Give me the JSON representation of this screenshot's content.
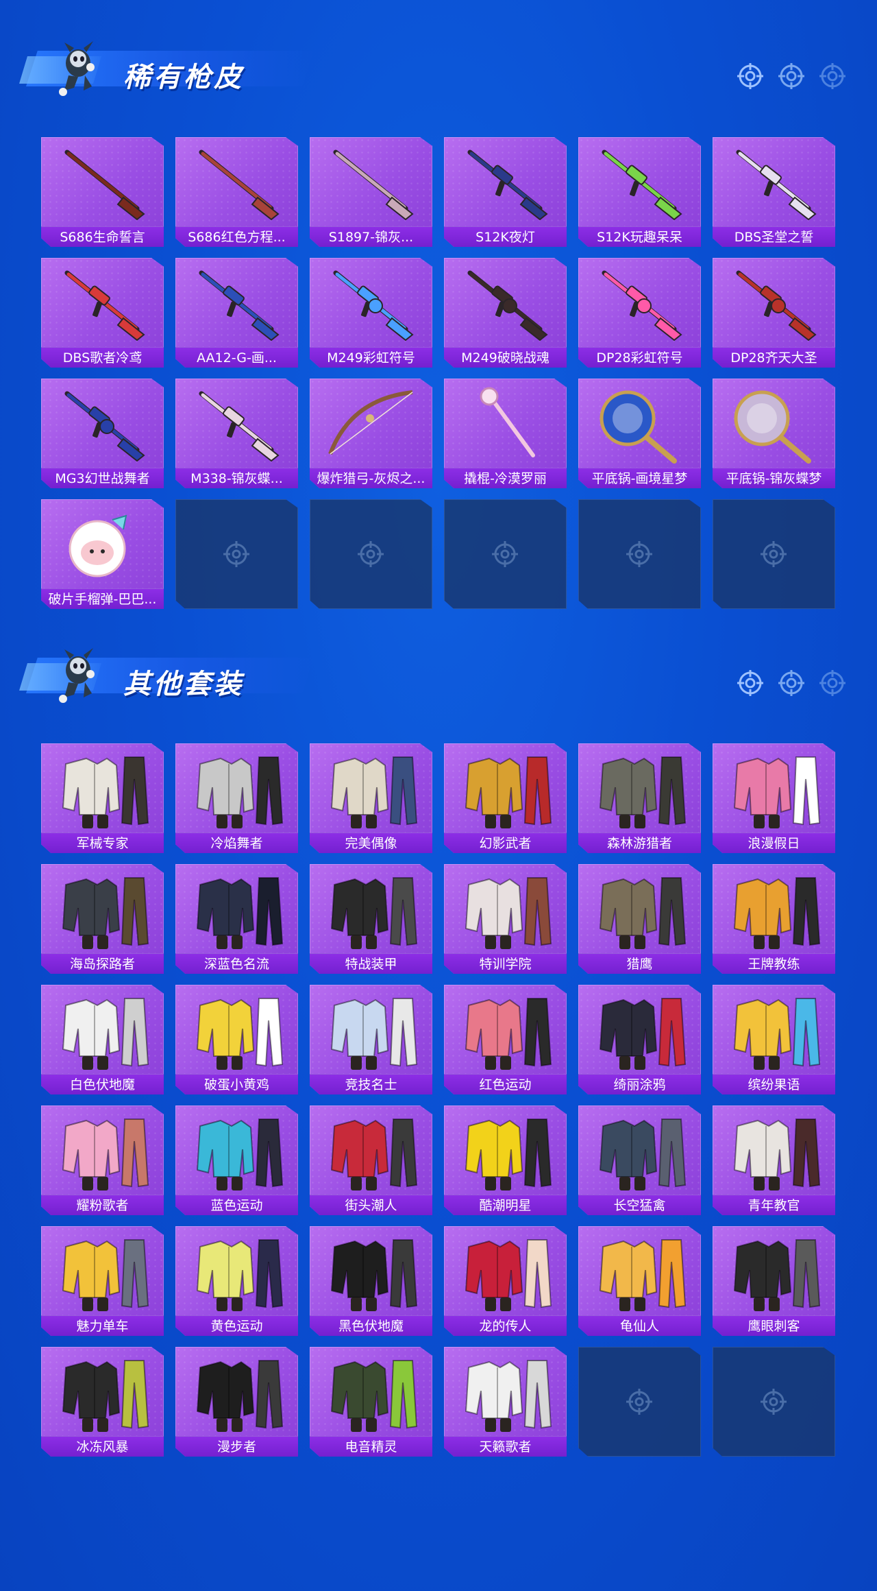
{
  "sections": [
    {
      "title": "稀有枪皮",
      "items": [
        {
          "label": "S686生命誓言",
          "kind": "shotgun",
          "color": "#7a2a1e"
        },
        {
          "label": "S686红色方程...",
          "kind": "shotgun",
          "color": "#a8433a"
        },
        {
          "label": "S1897-锦灰...",
          "kind": "shotgun",
          "color": "#c9a9b8"
        },
        {
          "label": "S12K夜灯",
          "kind": "rifle",
          "color": "#2a3a8a"
        },
        {
          "label": "S12K玩趣呆呆",
          "kind": "rifle",
          "color": "#7ad44a"
        },
        {
          "label": "DBS圣堂之誓",
          "kind": "rifle",
          "color": "#e6e0ef"
        },
        {
          "label": "DBS歌者冷鸢",
          "kind": "rifle",
          "color": "#d83a3a"
        },
        {
          "label": "AA12-G-画...",
          "kind": "rifle",
          "color": "#2c4fb8"
        },
        {
          "label": "M249彩虹符号",
          "kind": "lmg",
          "color": "#4aa0ff"
        },
        {
          "label": "M249破晓战魂",
          "kind": "lmg",
          "color": "#3a2a2a"
        },
        {
          "label": "DP28彩虹符号",
          "kind": "lmg",
          "color": "#ff5aa8"
        },
        {
          "label": "DP28齐天大圣",
          "kind": "lmg",
          "color": "#b8322a"
        },
        {
          "label": "MG3幻世战舞者",
          "kind": "lmg",
          "color": "#2840a8"
        },
        {
          "label": "M338-锦灰蝶...",
          "kind": "rifle",
          "color": "#e8d6e0"
        },
        {
          "label": "爆炸猎弓-灰烬之...",
          "kind": "bow",
          "color": "#8a5a3a"
        },
        {
          "label": "撬棍-冷漠罗丽",
          "kind": "staff",
          "color": "#f2c8e0"
        },
        {
          "label": "平底锅-画境星梦",
          "kind": "pan",
          "color": "#2a58c8"
        },
        {
          "label": "平底锅-锦灰蝶梦",
          "kind": "pan",
          "color": "#c8b8d8"
        },
        {
          "label": "破片手榴弹-巴巴...",
          "kind": "grenade",
          "color": "#ffffff"
        }
      ],
      "empty_slots": 5
    },
    {
      "title": "其他套装",
      "items": [
        {
          "label": "军械专家",
          "color": "#e8e4dc",
          "accent": "#3a3530"
        },
        {
          "label": "冷焰舞者",
          "color": "#c8c8c8",
          "accent": "#2a2a2a"
        },
        {
          "label": "完美偶像",
          "color": "#e0d8c8",
          "accent": "#3a4f80"
        },
        {
          "label": "幻影武者",
          "color": "#d8a030",
          "accent": "#b82a2a"
        },
        {
          "label": "森林游猎者",
          "color": "#6a6a60",
          "accent": "#3a3a34"
        },
        {
          "label": "浪漫假日",
          "color": "#e87aa8",
          "accent": "#ffffff"
        },
        {
          "label": "海岛探路者",
          "color": "#3a3f48",
          "accent": "#5a4a30"
        },
        {
          "label": "深蓝色名流",
          "color": "#2a3048",
          "accent": "#1a1e2e"
        },
        {
          "label": "特战装甲",
          "color": "#2a2a2a",
          "accent": "#4a4a4a"
        },
        {
          "label": "特训学院",
          "color": "#e8e0e0",
          "accent": "#8a4a3a"
        },
        {
          "label": "猎鹰",
          "color": "#7a6e58",
          "accent": "#3a3a38"
        },
        {
          "label": "王牌教练",
          "color": "#e8a030",
          "accent": "#2a2a2a"
        },
        {
          "label": "白色伏地魔",
          "color": "#f0f0f0",
          "accent": "#cfcfcf"
        },
        {
          "label": "破蛋小黄鸡",
          "color": "#f2d23a",
          "accent": "#ffffff"
        },
        {
          "label": "竞技名士",
          "color": "#c8d8f0",
          "accent": "#e8e8e8"
        },
        {
          "label": "红色运动",
          "color": "#e8788a",
          "accent": "#2a2a2a"
        },
        {
          "label": "绮丽涂鸦",
          "color": "#2a2a3a",
          "accent": "#c82a3a"
        },
        {
          "label": "缤纷果语",
          "color": "#f2c23a",
          "accent": "#4ab8e8"
        },
        {
          "label": "耀粉歌者",
          "color": "#f2a8c8",
          "accent": "#c8786a"
        },
        {
          "label": "蓝色运动",
          "color": "#3ab8d8",
          "accent": "#2a2a3a"
        },
        {
          "label": "街头潮人",
          "color": "#c82a3a",
          "accent": "#3a3a3a"
        },
        {
          "label": "酷潮明星",
          "color": "#f2d21a",
          "accent": "#2a2a2a"
        },
        {
          "label": "长空猛禽",
          "color": "#3a4a60",
          "accent": "#5a6070"
        },
        {
          "label": "青年教官",
          "color": "#e8e4e0",
          "accent": "#4a2a2a"
        },
        {
          "label": "魅力单车",
          "color": "#f2c23a",
          "accent": "#6a7080"
        },
        {
          "label": "黄色运动",
          "color": "#e8e878",
          "accent": "#2a2a4a"
        },
        {
          "label": "黑色伏地魔",
          "color": "#1e1e1e",
          "accent": "#3a3a3a"
        },
        {
          "label": "龙的传人",
          "color": "#c8203a",
          "accent": "#f2d8c8"
        },
        {
          "label": "龟仙人",
          "color": "#f2b84a",
          "accent": "#f2a030"
        },
        {
          "label": "鹰眼刺客",
          "color": "#2a2a2a",
          "accent": "#5a5a5a"
        },
        {
          "label": "冰冻风暴",
          "color": "#2a2a2a",
          "accent": "#b8c040"
        },
        {
          "label": "漫步者",
          "color": "#1e1e1e",
          "accent": "#3a3a3a"
        },
        {
          "label": "电音精灵",
          "color": "#3a4a30",
          "accent": "#8ac83a"
        },
        {
          "label": "天籁歌者",
          "color": "#f0f0f0",
          "accent": "#d8d8d8"
        }
      ],
      "empty_slots": 2
    }
  ]
}
